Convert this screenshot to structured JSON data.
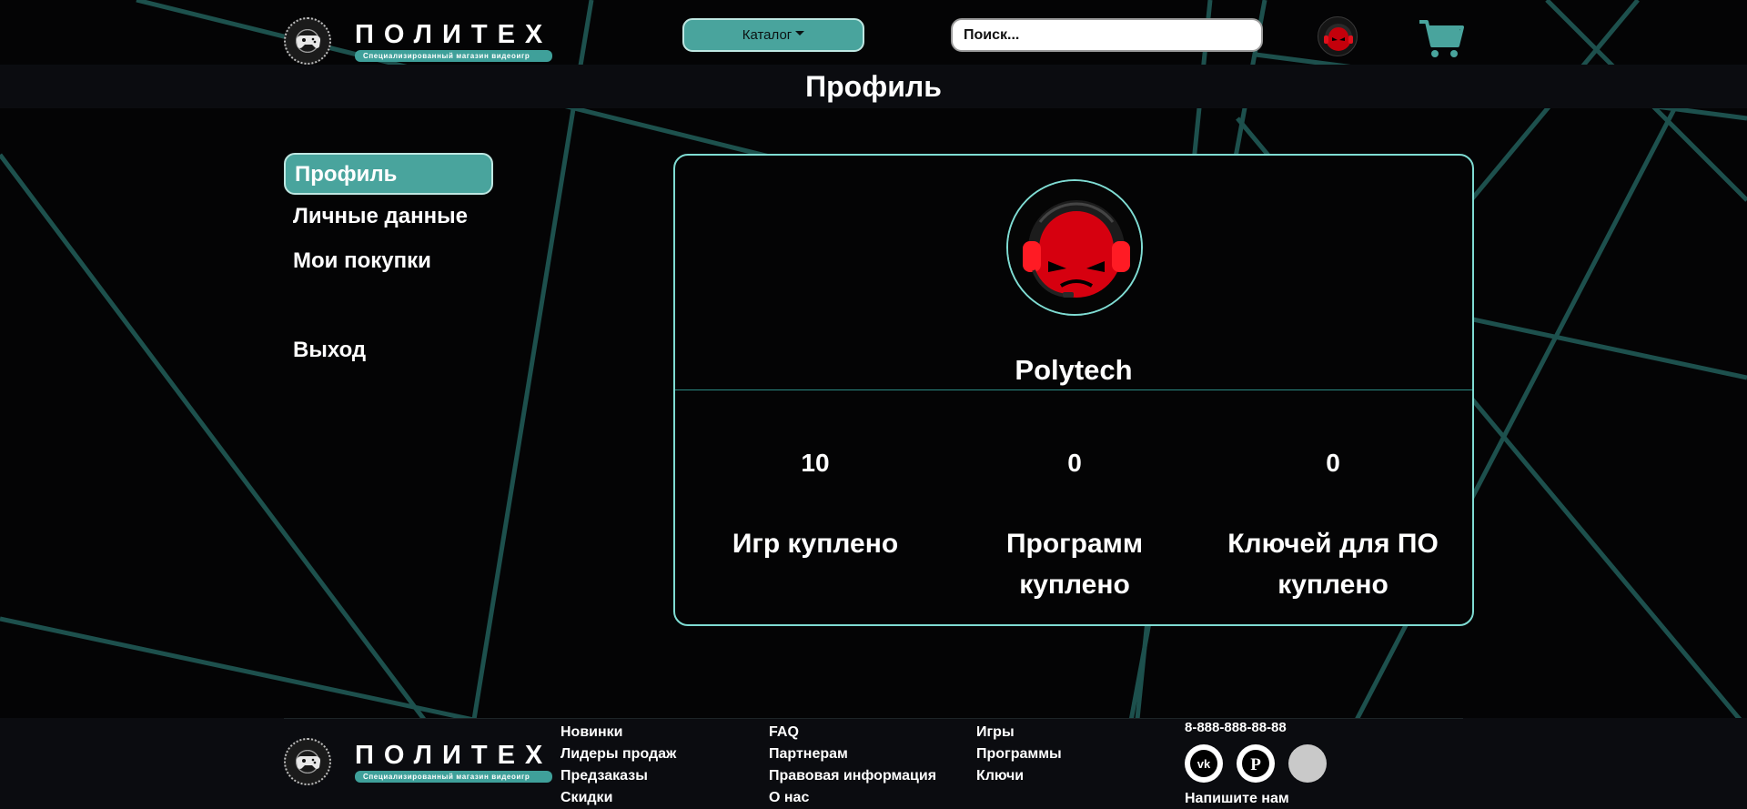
{
  "header": {
    "logo": {
      "name": "ПОЛИТЕХ",
      "tagline": "Специализированный магазин видеоигр"
    },
    "catalog_label": "Каталог",
    "search_placeholder": "Поиск...",
    "accent_color": "#49a49d"
  },
  "page": {
    "title": "Профиль"
  },
  "side_menu": {
    "items": [
      {
        "label": "Профиль",
        "active": true
      },
      {
        "label": "Личные данные",
        "active": false
      },
      {
        "label": "Мои покупки",
        "active": false
      },
      {
        "label": "Выход",
        "active": false
      }
    ]
  },
  "profile": {
    "username": "Polytech",
    "stats": [
      {
        "value": "10",
        "label": "Игр куплено"
      },
      {
        "value": "0",
        "label": "Программ куплено"
      },
      {
        "value": "0",
        "label": "Ключей для ПО куплено"
      }
    ]
  },
  "footer": {
    "logo": {
      "name": "ПОЛИТЕХ",
      "tagline": "Специализированный магазин видеоигр"
    },
    "columns": [
      [
        "Новинки",
        "Лидеры продаж",
        "Предзаказы",
        "Скидки"
      ],
      [
        "FAQ",
        "Партнерам",
        "Правовая информация",
        "О нас"
      ],
      [
        "Игры",
        "Программы",
        "Ключи"
      ]
    ],
    "phone": "8-888-888-88-88",
    "social_icons": [
      "vk-icon",
      "pinterest-icon",
      "blank-icon"
    ],
    "write_us": "Напишите нам"
  }
}
